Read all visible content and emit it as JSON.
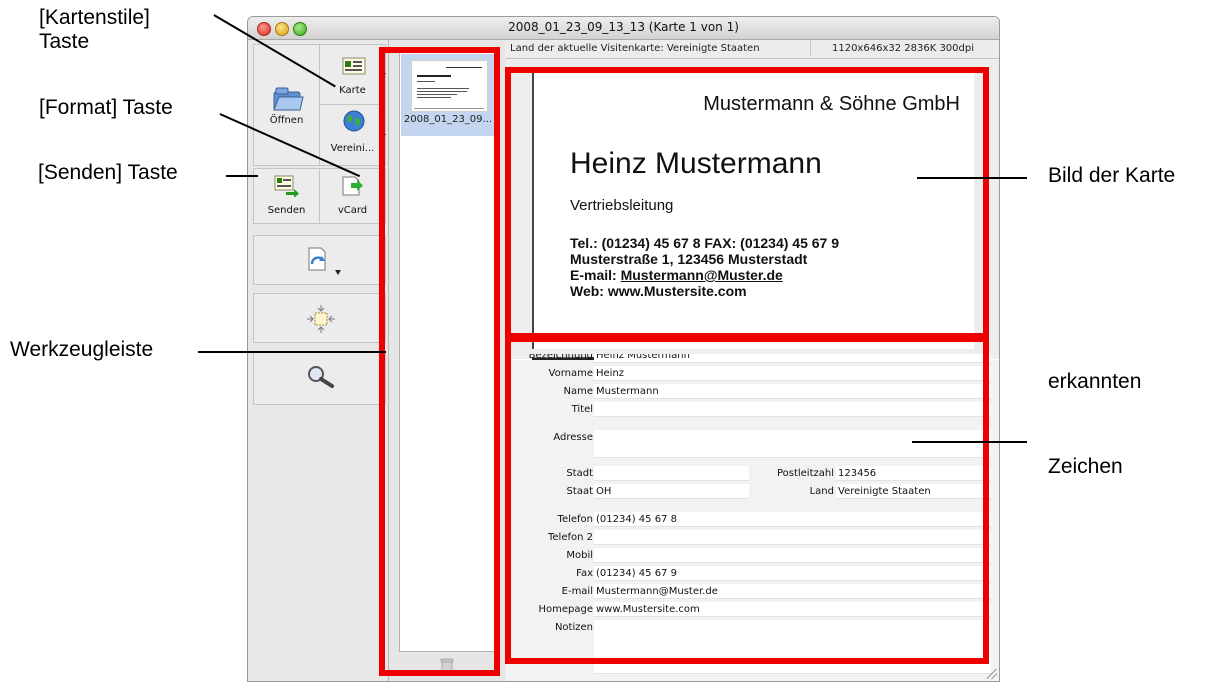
{
  "window": {
    "title": "2008_01_23_09_13_13 (Karte 1 von 1)"
  },
  "toolbar": {
    "open_label": "Öffnen",
    "card_label": "Karte",
    "country_label": "Vereini...",
    "send_label": "Senden",
    "vcard_label": "vCard"
  },
  "thumbnails": {
    "items": [
      {
        "name": "2008_01_23_09...",
        "selected": true
      }
    ]
  },
  "infobar": {
    "country_text": "Land der aktuelle Visitenkarte: Vereinigte Staaten",
    "image_spec": "1120x646x32 2836K 300dpi"
  },
  "card": {
    "company": "Mustermann & Söhne GmbH",
    "person": "Heinz Mustermann",
    "position": "Vertriebsleitung",
    "line1": "Tel.: (01234) 45 67 8 FAX: (01234) 45 67 9",
    "line2": "Musterstraße 1, 123456 Musterstadt",
    "email_prefix": "E-mail: ",
    "email": "Mustermann@Muster.de",
    "web": "Web: www.Mustersite.com"
  },
  "fields": {
    "header_label": "Bezeichnung",
    "header_value": "Heinz Mustermann",
    "vorname": {
      "label": "Vorname",
      "value": "Heinz"
    },
    "name": {
      "label": "Name",
      "value": "Mustermann"
    },
    "titel": {
      "label": "Titel",
      "value": ""
    },
    "adresse": {
      "label": "Adresse",
      "value": ""
    },
    "stadt": {
      "label": "Stadt",
      "value": ""
    },
    "postleitzahl": {
      "label": "Postleitzahl",
      "value": "123456"
    },
    "staat": {
      "label": "Staat",
      "value": "OH"
    },
    "land": {
      "label": "Land",
      "value": "Vereinigte Staaten"
    },
    "telefon": {
      "label": "Telefon",
      "value": "(01234) 45 67 8"
    },
    "telefon2": {
      "label": "Telefon 2",
      "value": ""
    },
    "mobil": {
      "label": "Mobil",
      "value": ""
    },
    "fax": {
      "label": "Fax",
      "value": "(01234) 45 67 9"
    },
    "email": {
      "label": "E-mail",
      "value": "Mustermann@Muster.de"
    },
    "homepage": {
      "label": "Homepage",
      "value": "www.Mustersite.com"
    },
    "notizen": {
      "label": "Notizen",
      "value": ""
    }
  },
  "annotations": {
    "kartenstile_1": "[Kartenstile]",
    "kartenstile_2": "Taste",
    "format": "[Format] Taste",
    "senden": "[Senden] Taste",
    "werkzeugleiste": "Werkzeugleiste",
    "bild": "Bild der Karte",
    "erkannten": "erkannten",
    "zeichen": "Zeichen"
  },
  "colors": {
    "highlight_frame": "#ee0000",
    "selection": "#c4d5ef"
  }
}
